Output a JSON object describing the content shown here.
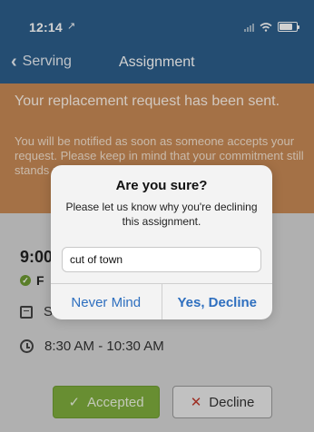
{
  "status_bar": {
    "time": "12:14",
    "location_arrow": "↗"
  },
  "nav": {
    "back_label": "Serving",
    "title": "Assignment"
  },
  "banner": {
    "title": "Your replacement request has been sent.",
    "body": "You will be notified as soon as someone accepts your request. Please keep in mind that your commitment still stands unless someone accepts."
  },
  "assignment": {
    "start_time": "9:00",
    "status": "F",
    "date": "Sunday, ...",
    "time_range": "8:30 AM - 10:30 AM",
    "accepted_label": "Accepted",
    "decline_label": "Decline"
  },
  "alert": {
    "title": "Are you sure?",
    "message": "Please let us know why you're declining this assignment.",
    "input_value": "cut of town",
    "cancel_label": "Never Mind",
    "confirm_label": "Yes, Decline"
  },
  "colors": {
    "header_bg": "#2c5e8b",
    "banner_bg": "#c98a56",
    "accepted_bg": "#7fae3e",
    "alert_button": "#2e6fbf"
  }
}
